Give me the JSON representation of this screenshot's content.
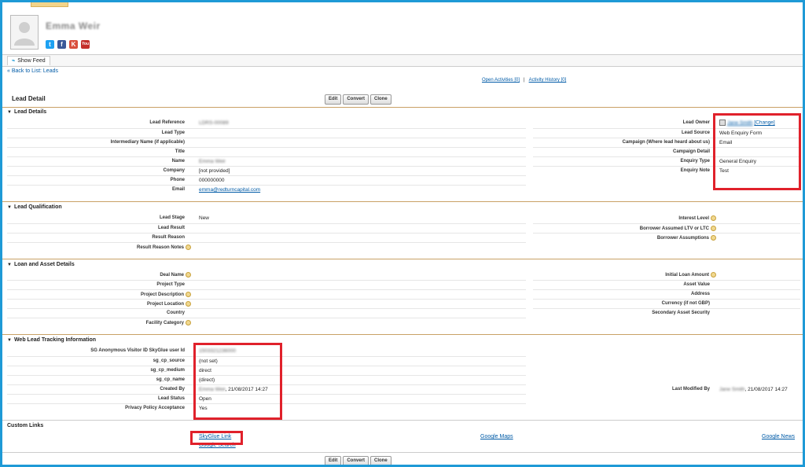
{
  "header": {
    "person_name": "Emma Weir",
    "social": [
      {
        "name": "twitter",
        "glyph": "t"
      },
      {
        "name": "facebook",
        "glyph": "f"
      },
      {
        "name": "klout",
        "glyph": "K"
      },
      {
        "name": "youtube",
        "glyph": "You"
      }
    ]
  },
  "feed": {
    "show_feed_label": "Show Feed"
  },
  "nav": {
    "back_to_list": "« Back to List: Leads",
    "open_activities": "Open Activities [0]",
    "activity_history": "Activity History [0]",
    "separator": "|"
  },
  "detail": {
    "title": "Lead Detail",
    "buttons": {
      "edit": "Edit",
      "convert": "Convert",
      "clone": "Clone"
    }
  },
  "lead_details": {
    "heading": "Lead Details",
    "left": [
      {
        "label": "Lead Reference",
        "value": "LDRS-00089"
      },
      {
        "label": "Lead Type",
        "value": ""
      },
      {
        "label": "Intermediary Name (if applicable)",
        "value": ""
      },
      {
        "label": "Title",
        "value": ""
      },
      {
        "label": "Name",
        "value": "Emma Weir"
      },
      {
        "label": "Company",
        "value": "[not provided]"
      },
      {
        "label": "Phone",
        "value": "000000000"
      },
      {
        "label": "Email",
        "value": "emma@redturncapital.com"
      }
    ],
    "right": [
      {
        "label": "Lead Owner",
        "value": "Jane Smith",
        "change": "[Change]"
      },
      {
        "label": "Lead Source",
        "value": "Web Enquiry Form"
      },
      {
        "label": "Campaign (Where lead heard about us)",
        "value": "Email"
      },
      {
        "label": "Campaign Detail",
        "value": ""
      },
      {
        "label": "Enquiry Type",
        "value": "General Enquiry"
      },
      {
        "label": "Enquiry Note",
        "value": "Test"
      }
    ]
  },
  "lead_qualification": {
    "heading": "Lead Qualification",
    "left": [
      {
        "label": "Lead Stage",
        "value": "New"
      },
      {
        "label": "Lead Result",
        "value": ""
      },
      {
        "label": "Result Reason",
        "value": ""
      },
      {
        "label": "Result Reason Notes",
        "value": ""
      }
    ],
    "right": [
      {
        "label": "Interest Level",
        "value": ""
      },
      {
        "label": "Borrower Assumed LTV or LTC",
        "value": ""
      },
      {
        "label": "Borrower Assumptions",
        "value": ""
      }
    ]
  },
  "loan_asset": {
    "heading": "Loan and Asset Details",
    "left": [
      {
        "label": "Deal Name",
        "value": ""
      },
      {
        "label": "Project Type",
        "value": ""
      },
      {
        "label": "Project Description",
        "value": ""
      },
      {
        "label": "Project Location",
        "value": ""
      },
      {
        "label": "Country",
        "value": ""
      },
      {
        "label": "Facility Category",
        "value": ""
      }
    ],
    "right": [
      {
        "label": "Initial Loan Amount",
        "value": ""
      },
      {
        "label": "Asset Value",
        "value": ""
      },
      {
        "label": "Address",
        "value": ""
      },
      {
        "label": "Currency (if not GBP)",
        "value": ""
      },
      {
        "label": "Secondary Asset Security",
        "value": ""
      }
    ]
  },
  "web_tracking": {
    "heading": "Web Lead Tracking Information",
    "left": [
      {
        "label": "SG Anonymous Visitor ID SkyGlue user Id",
        "value": "1503321236000"
      },
      {
        "label": "sg_cp_source",
        "value": "(not set)"
      },
      {
        "label": "sg_cp_medium",
        "value": "direct"
      },
      {
        "label": "sg_cp_name",
        "value": "(direct)"
      },
      {
        "label": "Created By",
        "value_hidden": "Emma Weir",
        "value": ", 21/08/2017 14:27"
      },
      {
        "label": "Lead Status",
        "value": "Open"
      },
      {
        "label": "Privacy Policy Acceptance",
        "value": "Yes"
      }
    ],
    "right_modified": {
      "label": "Last Modified By",
      "value_hidden": "Jane Smith",
      "value": ", 21/08/2017 14:27"
    }
  },
  "custom_links": {
    "heading": "Custom Links",
    "skyglue": "SkyGlue Link",
    "google_search": "Google Search",
    "google_maps": "Google Maps",
    "google_news": "Google News"
  },
  "colors": {
    "frame": "#1e9ad6",
    "highlight": "#e0212b",
    "link": "#015ba7"
  }
}
